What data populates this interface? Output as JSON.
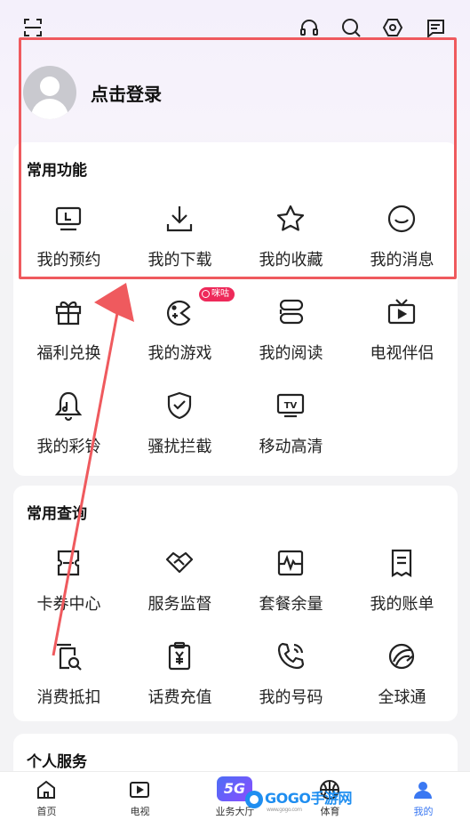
{
  "header": {
    "icons": [
      "scan-icon",
      "headset-icon",
      "search-icon",
      "settings-icon",
      "message-icon"
    ]
  },
  "profile": {
    "login_label": "点击登录"
  },
  "common_functions": {
    "title": "常用功能",
    "items": [
      {
        "label": "我的预约",
        "icon": "tv-screen-icon"
      },
      {
        "label": "我的下载",
        "icon": "download-icon"
      },
      {
        "label": "我的收藏",
        "icon": "star-icon"
      },
      {
        "label": "我的消息",
        "icon": "smile-icon"
      },
      {
        "label": "福利兑换",
        "icon": "gift-icon"
      },
      {
        "label": "我的游戏",
        "icon": "game-icon"
      },
      {
        "label": "我的阅读",
        "icon": "book-icon"
      },
      {
        "label": "电视伴侣",
        "icon": "tv-icon"
      },
      {
        "label": "我的彩铃",
        "icon": "bell-icon"
      },
      {
        "label": "骚扰拦截",
        "icon": "shield-icon"
      },
      {
        "label": "移动高清",
        "icon": "tv-hd-icon"
      }
    ],
    "game_badge": "咪咕"
  },
  "common_queries": {
    "title": "常用查询",
    "items": [
      {
        "label": "卡券中心",
        "icon": "coupon-icon"
      },
      {
        "label": "服务监督",
        "icon": "handshake-icon"
      },
      {
        "label": "套餐余量",
        "icon": "chart-icon"
      },
      {
        "label": "我的账单",
        "icon": "bill-icon"
      },
      {
        "label": "消费抵扣",
        "icon": "deduct-icon"
      },
      {
        "label": "话费充值",
        "icon": "recharge-icon"
      },
      {
        "label": "我的号码",
        "icon": "phone-icon"
      },
      {
        "label": "全球通",
        "icon": "global-icon"
      }
    ]
  },
  "personal_services": {
    "title": "个人服务"
  },
  "tabbar": {
    "items": [
      {
        "label": "首页",
        "icon": "home-icon"
      },
      {
        "label": "电视",
        "icon": "tv-play-icon"
      },
      {
        "label": "业务大厅",
        "icon": "5g-icon"
      },
      {
        "label": "体育",
        "icon": "basketball-icon"
      },
      {
        "label": "我的",
        "icon": "user-icon"
      }
    ],
    "fiveg_label": "5G",
    "active_color": "#3a78f2"
  },
  "watermark": {
    "text": "GOGO手游网",
    "sub": "www.gogo.com"
  },
  "colors": {
    "highlight": "#ef5a5e",
    "badge": "#ee2a5a"
  }
}
